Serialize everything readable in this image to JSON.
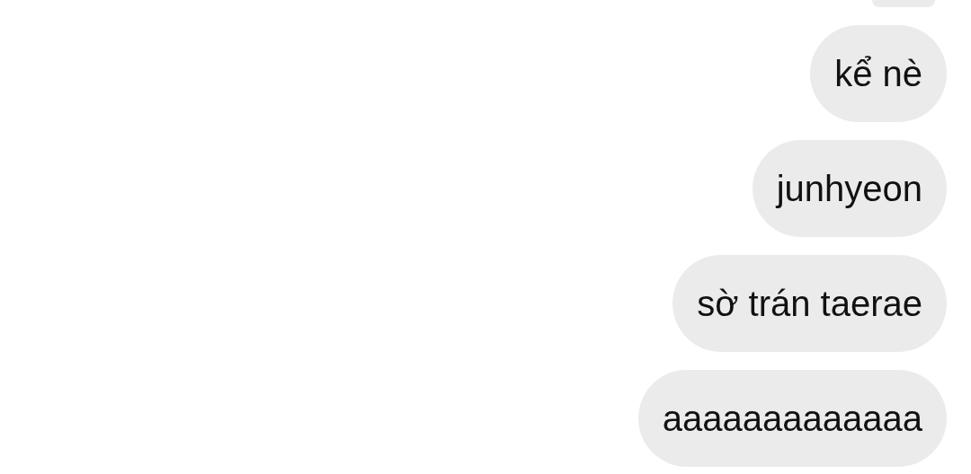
{
  "messages": [
    {
      "text": "kể nè"
    },
    {
      "text": "junhyeon"
    },
    {
      "text": "sờ trán taerae"
    },
    {
      "text": "aaaaaaaaaaaaa"
    }
  ]
}
